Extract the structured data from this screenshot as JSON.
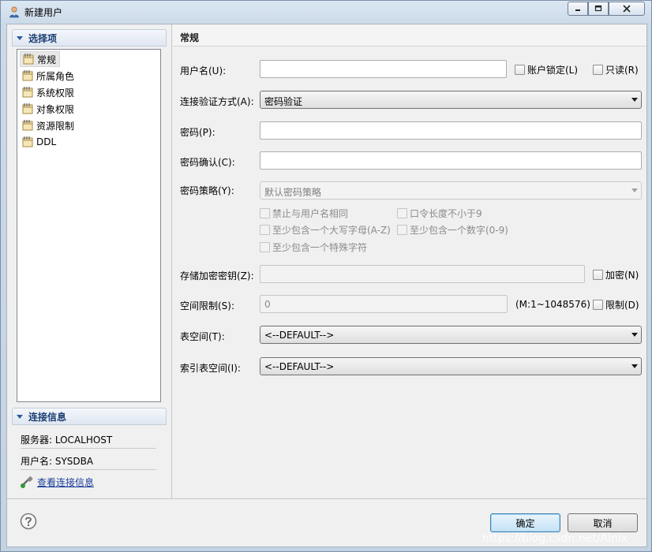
{
  "window": {
    "title": "新建用户",
    "icon": "user-icon"
  },
  "nav": {
    "header": "选择项",
    "items": [
      {
        "label": "常规",
        "selected": true
      },
      {
        "label": "所属角色",
        "selected": false
      },
      {
        "label": "系统权限",
        "selected": false
      },
      {
        "label": "对象权限",
        "selected": false
      },
      {
        "label": "资源限制",
        "selected": false
      },
      {
        "label": "DDL",
        "selected": false
      }
    ]
  },
  "connection": {
    "header": "连接信息",
    "server": "服务器: LOCALHOST",
    "user": "用户名: SYSDBA",
    "link": "查看连接信息"
  },
  "form": {
    "title": "常规",
    "username_label": "用户名(U):",
    "username_value": "",
    "lock_label": "账户锁定(L)",
    "readonly_label": "只读(R)",
    "auth_label": "连接验证方式(A):",
    "auth_value": "密码验证",
    "password_label": "密码(P):",
    "confirm_label": "密码确认(C):",
    "policy_label": "密码策略(Y):",
    "policy_value": "默认密码策略",
    "policy_options": {
      "no_same_as_user": "禁止与用户名相同",
      "min_length": "口令长度不小于9",
      "uppercase": "至少包含一个大写字母(A-Z)",
      "digit": "至少包含一个数字(0-9)",
      "special": "至少包含一个特殊字符"
    },
    "storage_key_label": "存储加密密钥(Z):",
    "encrypt_label": "加密(N)",
    "space_label": "空间限制(S):",
    "space_value": "0",
    "space_range": "(M:1~1048576)",
    "limit_label": "限制(D)",
    "tablespace_label": "表空间(T):",
    "tablespace_value": "<--DEFAULT-->",
    "index_tablespace_label": "索引表空间(I):",
    "index_tablespace_value": "<--DEFAULT-->"
  },
  "buttons": {
    "ok": "确定",
    "cancel": "取消"
  },
  "watermark": "https://blog.csdn.net/Alnix",
  "colors": {
    "nav_header": "#1a3d73",
    "link": "#1a3d99",
    "default_button_border": "#3c7fb1"
  }
}
